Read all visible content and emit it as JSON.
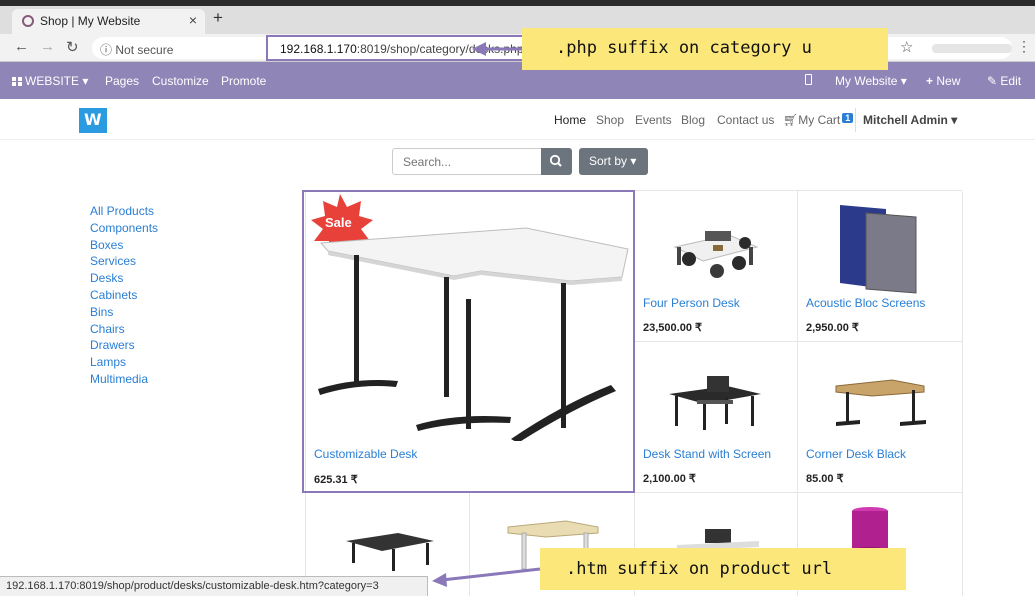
{
  "browser": {
    "tab_title": "Shop | My Website",
    "tab_close": "×",
    "new_tab": "+",
    "security_label": "Not secure",
    "url_host": "192.168.1.170",
    "url_rest": ":8019/shop/category/desks.php",
    "status_url": "192.168.1.170:8019/shop/product/desks/customizable-desk.htm?category=3"
  },
  "odoo_bar": {
    "website_menu": "WEBSITE",
    "pages": "Pages",
    "customize": "Customize",
    "promote": "Promote",
    "site_switcher": "My Website",
    "new": "New",
    "edit": "Edit"
  },
  "header": {
    "nav": [
      "Home",
      "Shop",
      "Events",
      "Blog",
      "Contact us"
    ],
    "cart_label": "My Cart",
    "cart_count": "1",
    "user": "Mitchell Admin"
  },
  "search": {
    "placeholder": "Search...",
    "sort_label": "Sort by"
  },
  "categories": [
    "All Products",
    "Components",
    "Boxes",
    "Services",
    "Desks",
    "Cabinets",
    "Bins",
    "Chairs",
    "Drawers",
    "Lamps",
    "Multimedia"
  ],
  "products": [
    {
      "name": "Customizable Desk",
      "price": "625.31 ₹",
      "badge": "Sale"
    },
    {
      "name": "Four Person Desk",
      "price": "23,500.00 ₹"
    },
    {
      "name": "Acoustic Bloc Screens",
      "price": "2,950.00 ₹"
    },
    {
      "name": "Desk Stand with Screen",
      "price": "2,100.00 ₹"
    },
    {
      "name": "Corner Desk Black",
      "price": "85.00 ₹"
    }
  ],
  "annotations": {
    "php_note": ".php suffix on category u",
    "htm_note": ".htm suffix on product url"
  },
  "colors": {
    "odoo_purple": "#8f85b6",
    "annotation_purple": "#8a78b8",
    "link_blue": "#2a7fd4",
    "callout_yellow": "#fbe77a",
    "sale_red": "#e8413a"
  }
}
